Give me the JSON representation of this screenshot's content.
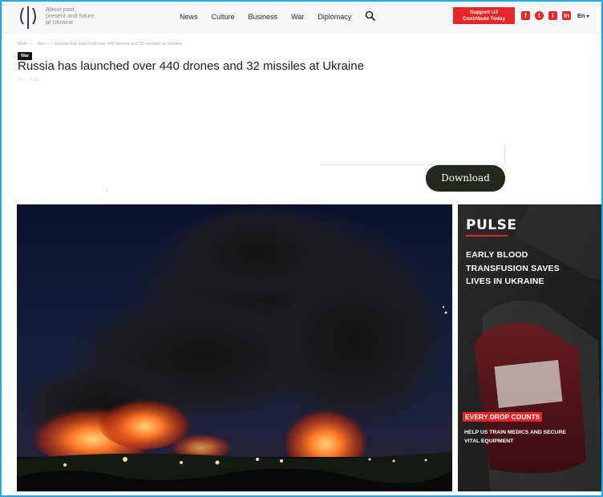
{
  "header": {
    "tagline": [
      "About past,",
      "present and future",
      "of Ukraine"
    ],
    "nav": [
      "News",
      "Culture",
      "Business",
      "War",
      "Diplomacy"
    ],
    "support": [
      "Support UJ",
      "Contribute Today"
    ],
    "social": [
      "f",
      "t",
      "i",
      "in"
    ],
    "language": "En"
  },
  "breadcrumb": [
    "Main —",
    "War —",
    "Russia has launched over 440 drones and 32 missiles at Ukraine"
  ],
  "article": {
    "badge": "War",
    "title": "Russia has launched over 440 drones and 32 missiles at Ukraine",
    "meta": "Thu · 2025 · · · · ·"
  },
  "download": {
    "label": "Download"
  },
  "ad": {
    "logo": "PULSE",
    "headline": [
      "EARLY BLOOD",
      "TRANSFUSION SAVES",
      "LIVES IN UKRAINE"
    ],
    "badge": "EVERY DROP COUNTS",
    "sub": [
      "HELP US TRAIN MEDICS AND SECURE",
      "VITAL EQUIPMENT"
    ]
  },
  "colors": {
    "accent": "#e8262a",
    "frame": "#22a7e6",
    "button_dark": "#23291f"
  }
}
